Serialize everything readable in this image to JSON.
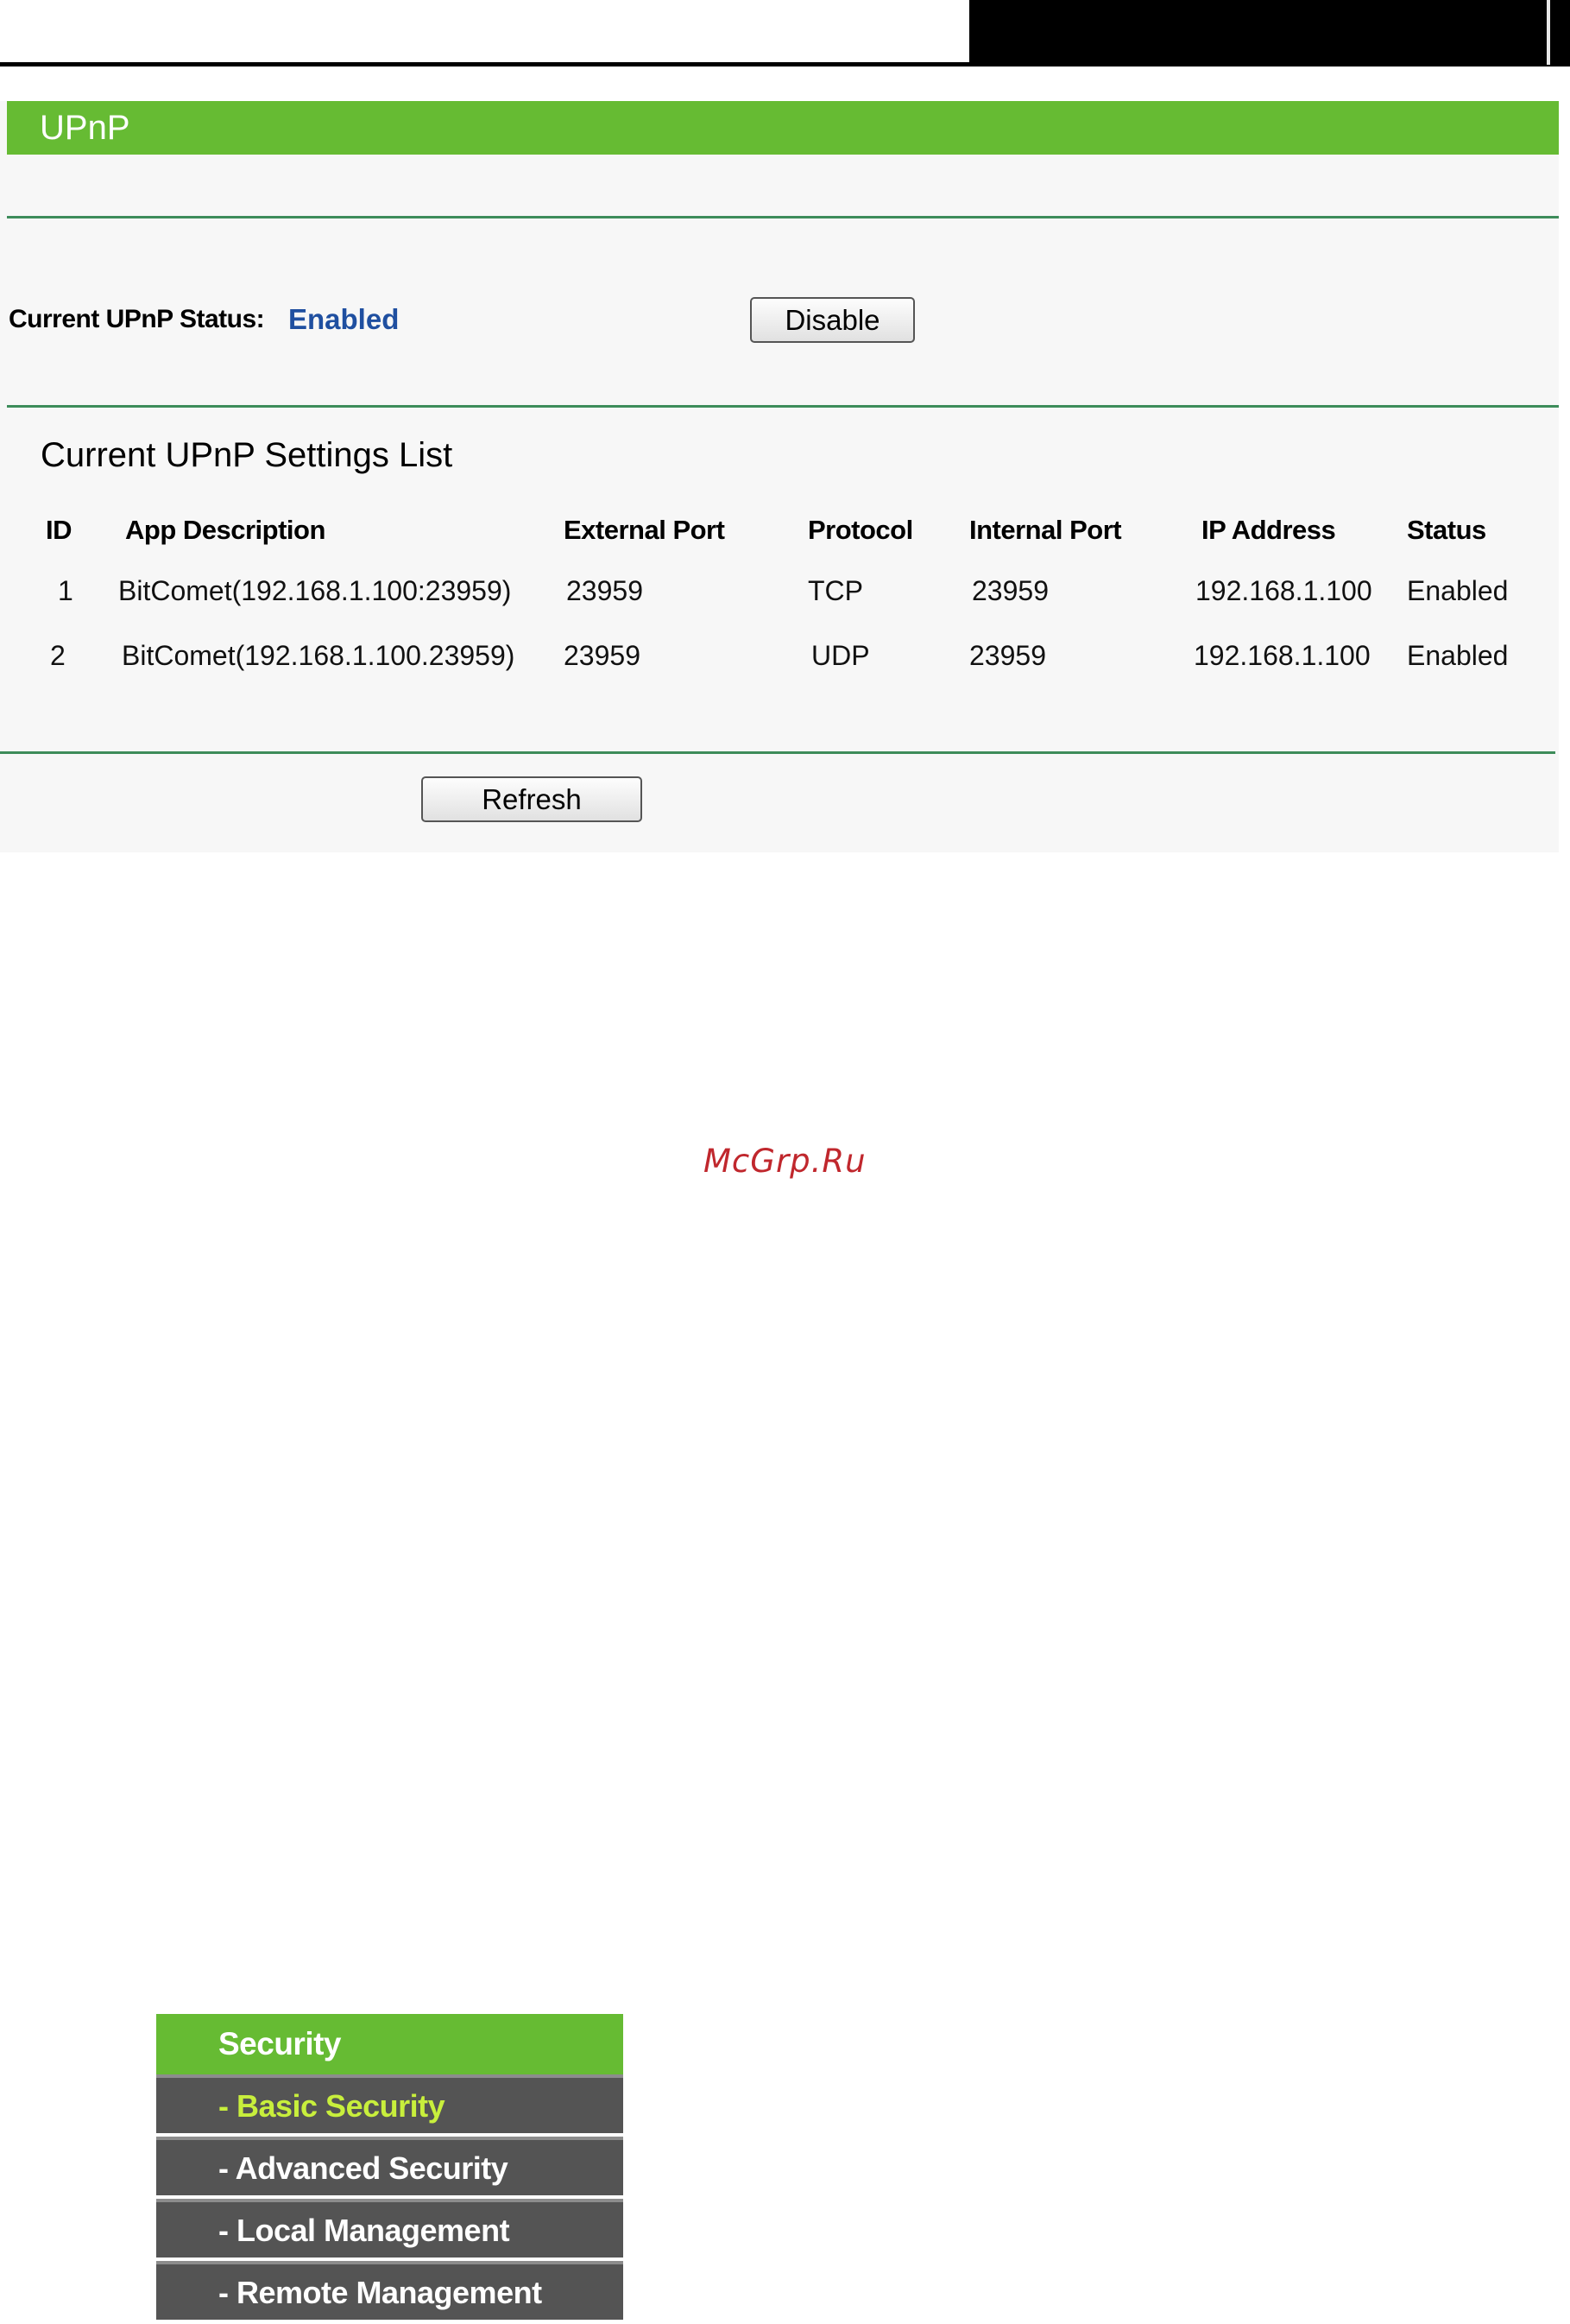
{
  "page_title": "UPnP",
  "status": {
    "label": "Current UPnP Status:",
    "value": "Enabled",
    "value_color": "#1f4fa0",
    "disable_label": "Disable"
  },
  "settings_list": {
    "title": "Current UPnP Settings List",
    "columns": [
      "ID",
      "App Description",
      "External Port",
      "Protocol",
      "Internal Port",
      "IP Address",
      "Status"
    ],
    "rows": [
      [
        "1",
        "BitComet(192.168.1.100:23959)",
        "23959",
        "TCP",
        "23959",
        "192.168.1.100",
        "Enabled"
      ],
      [
        "2",
        "BitComet(192.168.1.100.23959)",
        "23959",
        "UDP",
        "23959",
        "192.168.1.100",
        "Enabled"
      ]
    ]
  },
  "refresh_label": "Refresh",
  "watermark": "McGrp.Ru",
  "menu": {
    "heading": "Security",
    "items": [
      "- Basic Security",
      "- Advanced Security",
      "- Local Management",
      "- Remote Management"
    ],
    "active_index": 0
  },
  "colors": {
    "accent_green": "#66bb33",
    "rule_green": "#3d8c5a",
    "menu_gray": "#545454",
    "menu_active_text": "#c8ef3c",
    "watermark_red": "#c0272d"
  }
}
